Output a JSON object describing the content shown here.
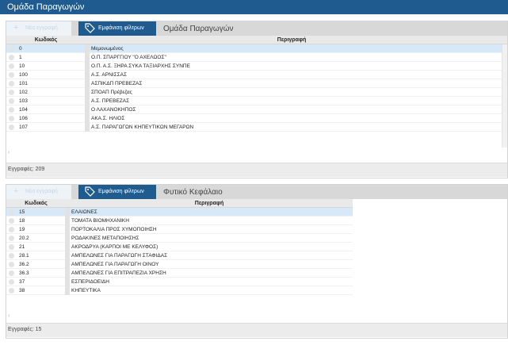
{
  "window": {
    "title": "Ομάδα Παραγωγών"
  },
  "panel1": {
    "new_label": "Νέα εγγραφή",
    "filter_label": "Εμφάνιση φίλτρων",
    "title": "Ομάδα Παραγωγών",
    "columns": [
      "Κωδικός",
      "Περιγραφή"
    ],
    "rows": [
      {
        "code": "0",
        "desc": "Μεμονωμένος"
      },
      {
        "code": "1",
        "desc": "Ο.Π. ΣΠΑΡΓΓΙΟΥ \"Ο ΑΧΕΛΩΟΣ\""
      },
      {
        "code": "10",
        "desc": "Ο.Π. Α.Σ. ΞΗΡΑ ΣΥΚΑ ΤΑΞΙΑΡΧΗΣ ΣΥΝΠΕ"
      },
      {
        "code": "100",
        "desc": "Α.Σ. ΑΡΝΙΣΣΑΣ"
      },
      {
        "code": "101",
        "desc": "ΑΣΠΙΚΔΠ ΠΡΕΒΕΖΑΣ"
      },
      {
        "code": "102",
        "desc": "ΣΠΟΑΠ Πρέβεζας"
      },
      {
        "code": "103",
        "desc": "Α.Σ. ΠΡΕΒΕΖΑΣ"
      },
      {
        "code": "104",
        "desc": "Ο ΛΑΧΑΝΟΚΗΠΟΣ"
      },
      {
        "code": "106",
        "desc": "ΑΚΑ.Σ. ΗΛΙΟΣ"
      },
      {
        "code": "107",
        "desc": "Α.Σ. ΠΑΡΑΓΩΓΩΝ ΚΗΠΕΥΤΙΚΩΝ ΜΕΓΑΡΩΝ"
      }
    ],
    "footer": "Εγγραφές: 209"
  },
  "panel2": {
    "new_label": "Νέα εγγραφή",
    "filter_label": "Εμφάνιση φίλτρων",
    "title": "Φυτικό Κεφάλαιο",
    "columns": [
      "Κωδικός",
      "Περιγραφή"
    ],
    "rows": [
      {
        "code": "15",
        "desc": "ΕΛΑΙΩΝΕΣ"
      },
      {
        "code": "18",
        "desc": "ΤΟΜΑΤΑ ΒΙΟΜΗΧΑΝΙΚΗ"
      },
      {
        "code": "19",
        "desc": "ΠΟΡΤΟΚΑΛΙΑ ΠΡΟΣ ΧΥΜΟΠΟΙΗΣΗ"
      },
      {
        "code": "20.2",
        "desc": "ΡΟΔΑΚΙΝΕΣ ΜΕΤΑΠΟΙΗΣΗΣ"
      },
      {
        "code": "21",
        "desc": "ΑΚΡΟΔΡΥΑ (ΚΑΡΠΟΙ ΜΕ ΚΕΛΥΦΟΣ)"
      },
      {
        "code": "28.1",
        "desc": "ΑΜΠΕΛΩΝΕΣ ΓΙΑ ΠΑΡΑΓΩΓΗ ΣΤΑΦΙΔΑΣ"
      },
      {
        "code": "36.2",
        "desc": "ΑΜΠΕΛΩΝΕΣ ΓΙΑ ΠΑΡΑΓΩΓΗ ΟΙΝΟΥ"
      },
      {
        "code": "36.3",
        "desc": "ΑΜΠΕΛΩΝΕΣ ΓΙΑ ΕΠΙΤΡΑΠΕΖΙΑ ΧΡΗΣΗ"
      },
      {
        "code": "37",
        "desc": "ΕΣΠΕΡΙΔΟΕΙΔΗ"
      },
      {
        "code": "38",
        "desc": "ΚΗΠΕΥΤΙΚΑ"
      }
    ],
    "footer": "Εγγραφές: 15"
  },
  "icons": {
    "new": "plus-icon",
    "filter": "tag-icon",
    "scroll_left": "chevron-left-icon"
  },
  "colors": {
    "titlebar": "#1f5b8f",
    "filter_button": "#1f5b8f",
    "selected_row": "#d7e9f8"
  }
}
